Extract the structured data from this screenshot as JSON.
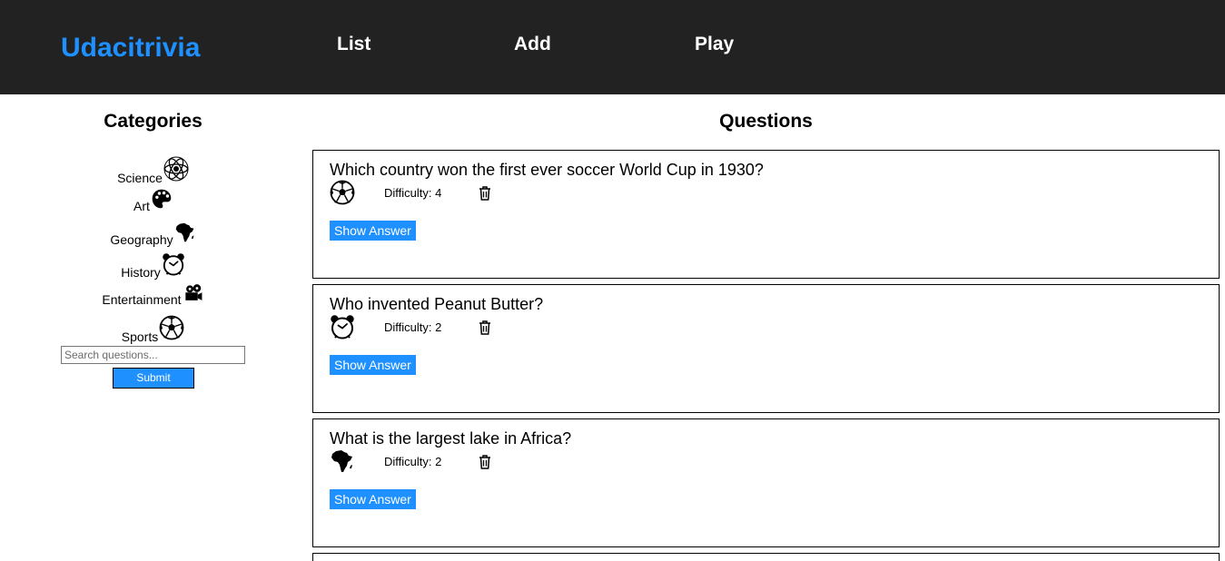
{
  "header": {
    "brand": "Udacitrivia",
    "nav": [
      {
        "label": "List"
      },
      {
        "label": "Add"
      },
      {
        "label": "Play"
      }
    ]
  },
  "sidebar": {
    "title": "Categories",
    "categories": [
      {
        "label": "Science",
        "icon": "science-atom-icon"
      },
      {
        "label": "Art",
        "icon": "art-palette-icon"
      },
      {
        "label": "Geography",
        "icon": "geography-africa-icon"
      },
      {
        "label": "History",
        "icon": "history-clock-icon"
      },
      {
        "label": "Entertainment",
        "icon": "entertainment-camera-icon"
      },
      {
        "label": "Sports",
        "icon": "sports-ball-icon"
      }
    ],
    "search": {
      "placeholder": "Search questions...",
      "value": ""
    },
    "submit_label": "Submit"
  },
  "main": {
    "title": "Questions",
    "questions": [
      {
        "text": "Which country won the first ever soccer World Cup in 1930?",
        "category_icon": "sports-ball-icon",
        "difficulty": "Difficulty: 4",
        "show_answer": "Show Answer"
      },
      {
        "text": "Who invented Peanut Butter?",
        "category_icon": "history-clock-icon",
        "difficulty": "Difficulty: 2",
        "show_answer": "Show Answer"
      },
      {
        "text": "What is the largest lake in Africa?",
        "category_icon": "geography-africa-icon",
        "difficulty": "Difficulty: 2",
        "show_answer": "Show Answer"
      }
    ]
  },
  "colors": {
    "navbar": "#222222",
    "brand": "#1e90ff",
    "button": "#1e90ff"
  }
}
